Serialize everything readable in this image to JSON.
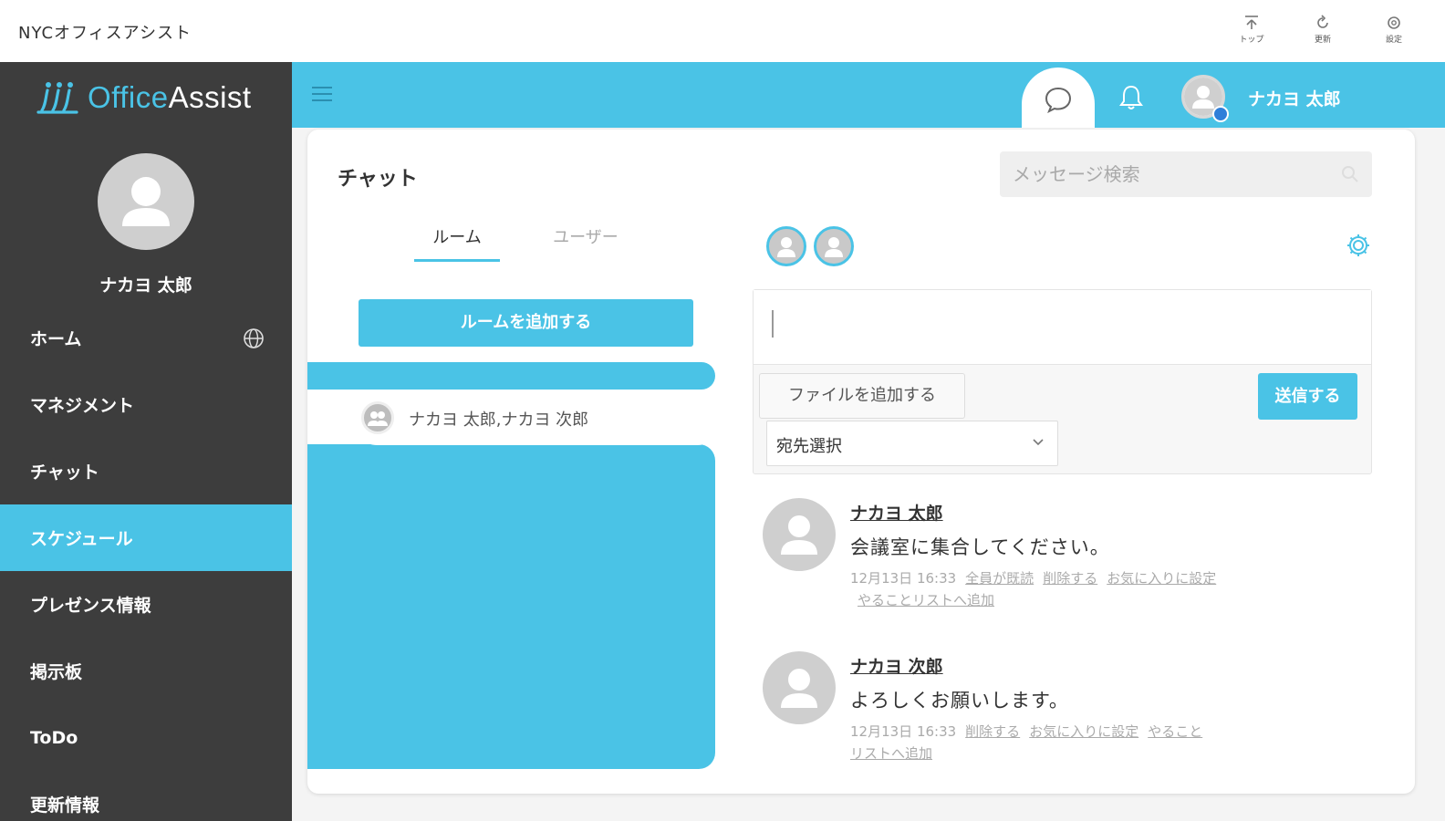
{
  "app": {
    "title": "NYCオフィスアシスト",
    "tools": [
      {
        "icon": "top-icon",
        "label": "トップ"
      },
      {
        "icon": "refresh-icon",
        "label": "更新"
      },
      {
        "icon": "settings-icon",
        "label": "設定"
      }
    ]
  },
  "sidebar": {
    "logo_text": "OfficeAssist",
    "user_name": "ナカヨ 太郎",
    "items": [
      {
        "label": "ホーム",
        "icon": "globe-icon"
      },
      {
        "label": "マネジメント"
      },
      {
        "label": "チャット"
      },
      {
        "label": "スケジュール",
        "active": true
      },
      {
        "label": "プレゼンス情報"
      },
      {
        "label": "掲示板"
      },
      {
        "label": "ToDo"
      },
      {
        "label": "更新情報"
      }
    ]
  },
  "header": {
    "user_name": "ナカヨ 太郎",
    "accent": "#4ac3e6",
    "sidebar_bg": "#3d3d3d"
  },
  "chat": {
    "title": "チャット",
    "search_placeholder": "メッセージ検索",
    "tabs": [
      "ルーム",
      "ユーザー"
    ],
    "add_room_label": "ルームを追加する",
    "rooms": [
      {
        "name": "ナカヨ 太郎,ナカヨ 次郎"
      }
    ],
    "composer": {
      "add_file_label": "ファイルを追加する",
      "send_label": "送信する",
      "destination_value": "宛先選択"
    },
    "messages": [
      {
        "sender": "ナカヨ 太郎",
        "text": "会議室に集合してください。",
        "timestamp": "12月13日 16:33",
        "actions": [
          "全員が既読",
          "削除する",
          "お気に入りに設定",
          "やることリストへ追加"
        ]
      },
      {
        "sender": "ナカヨ 次郎",
        "text": "よろしくお願いします。",
        "timestamp": "12月13日 16:33",
        "actions": [
          "削除する",
          "お気に入りに設定",
          "やること",
          "リストへ追加"
        ]
      }
    ]
  }
}
